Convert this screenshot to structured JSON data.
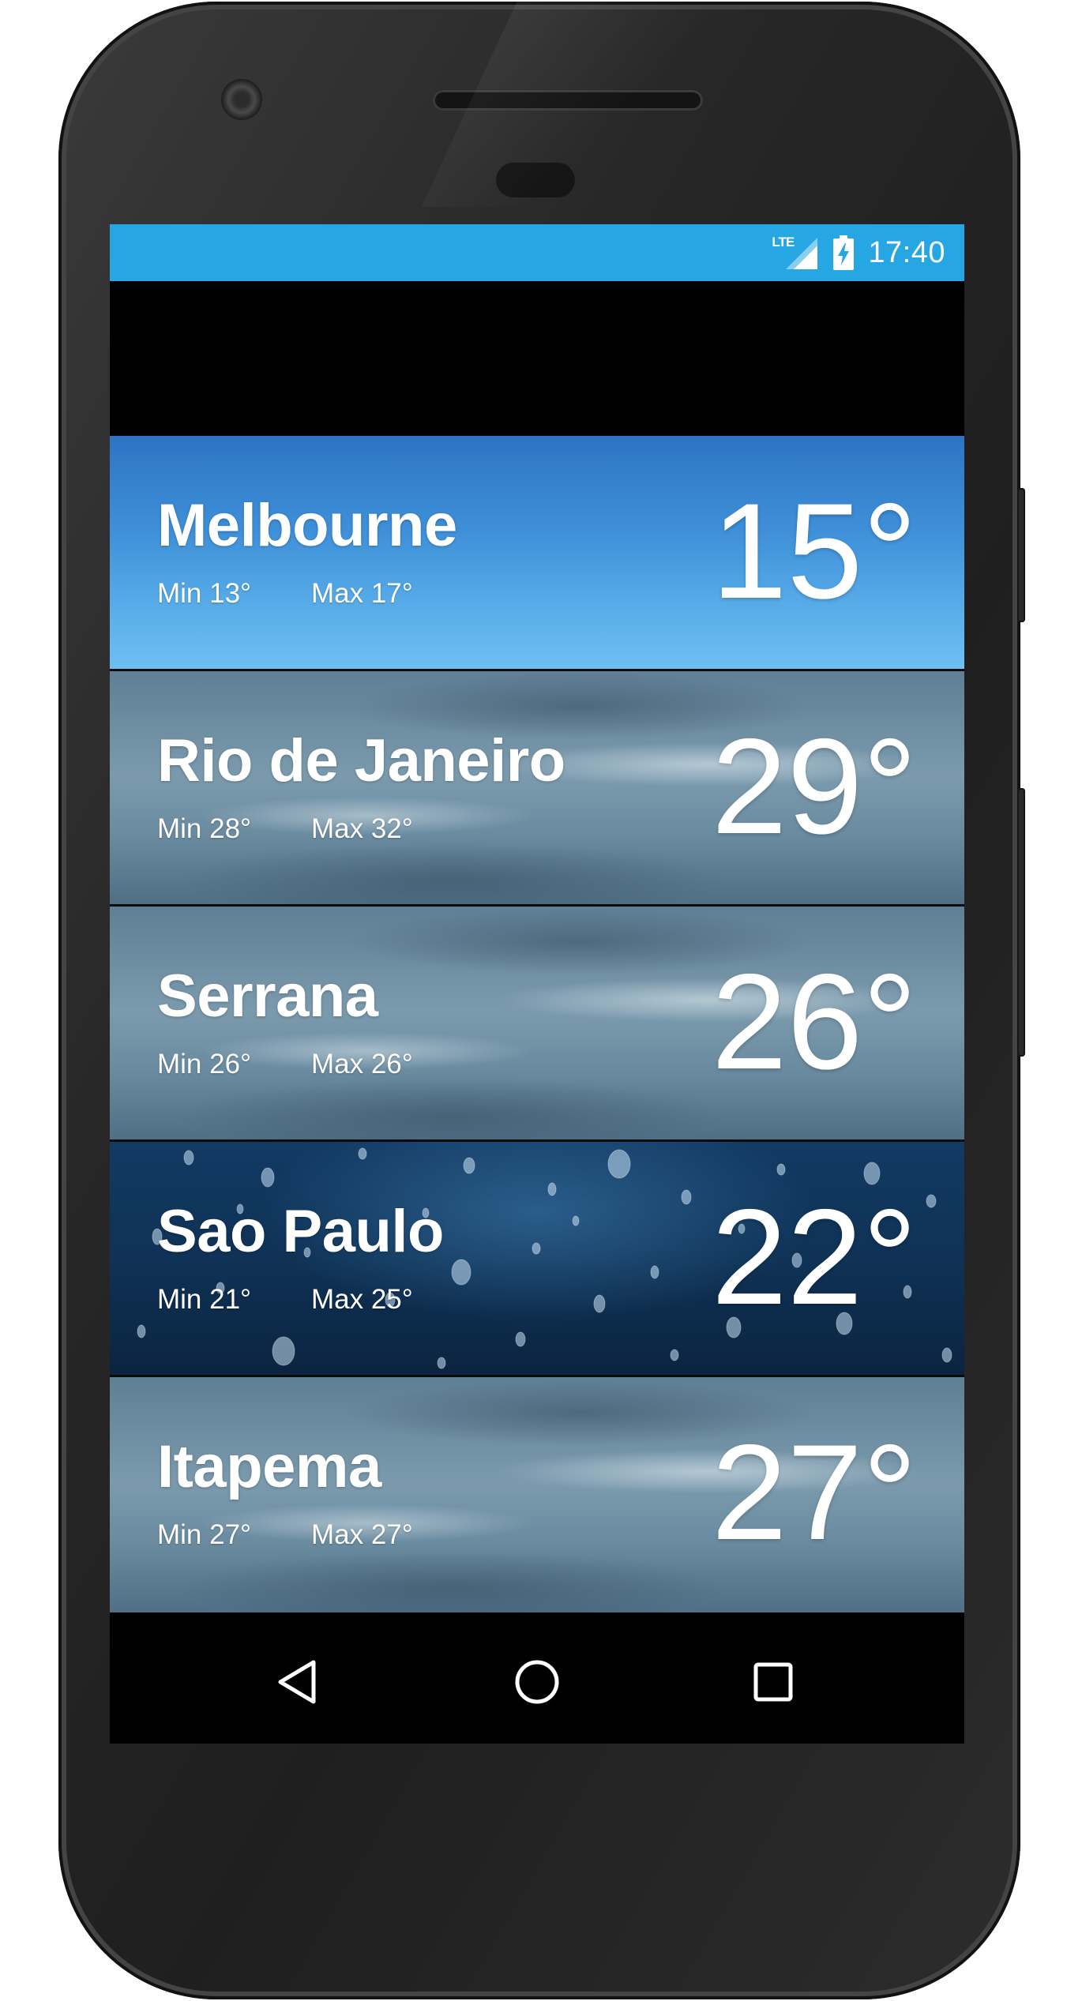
{
  "status_bar": {
    "network": "LTE",
    "time": "17:40",
    "color": "#27a6e4"
  },
  "cities": [
    {
      "name": "Melbourne",
      "min": "Min 13°",
      "max": "Max 17°",
      "temp": "15°",
      "condition_icon": "sunny-sky"
    },
    {
      "name": "Rio de Janeiro",
      "min": "Min 28°",
      "max": "Max 32°",
      "temp": "29°",
      "condition_icon": "cloudy-sky"
    },
    {
      "name": "Serrana",
      "min": "Min 26°",
      "max": "Max 26°",
      "temp": "26°",
      "condition_icon": "cloudy-sky"
    },
    {
      "name": "Sao Paulo",
      "min": "Min 21°",
      "max": "Max 25°",
      "temp": "22°",
      "condition_icon": "rain-drops"
    },
    {
      "name": "Itapema",
      "min": "Min 27°",
      "max": "Max 27°",
      "temp": "27°",
      "condition_icon": "cloudy-sky"
    }
  ],
  "nav": {
    "back_icon": "back-triangle-icon",
    "home_icon": "home-circle-icon",
    "recents_icon": "recents-square-icon"
  }
}
